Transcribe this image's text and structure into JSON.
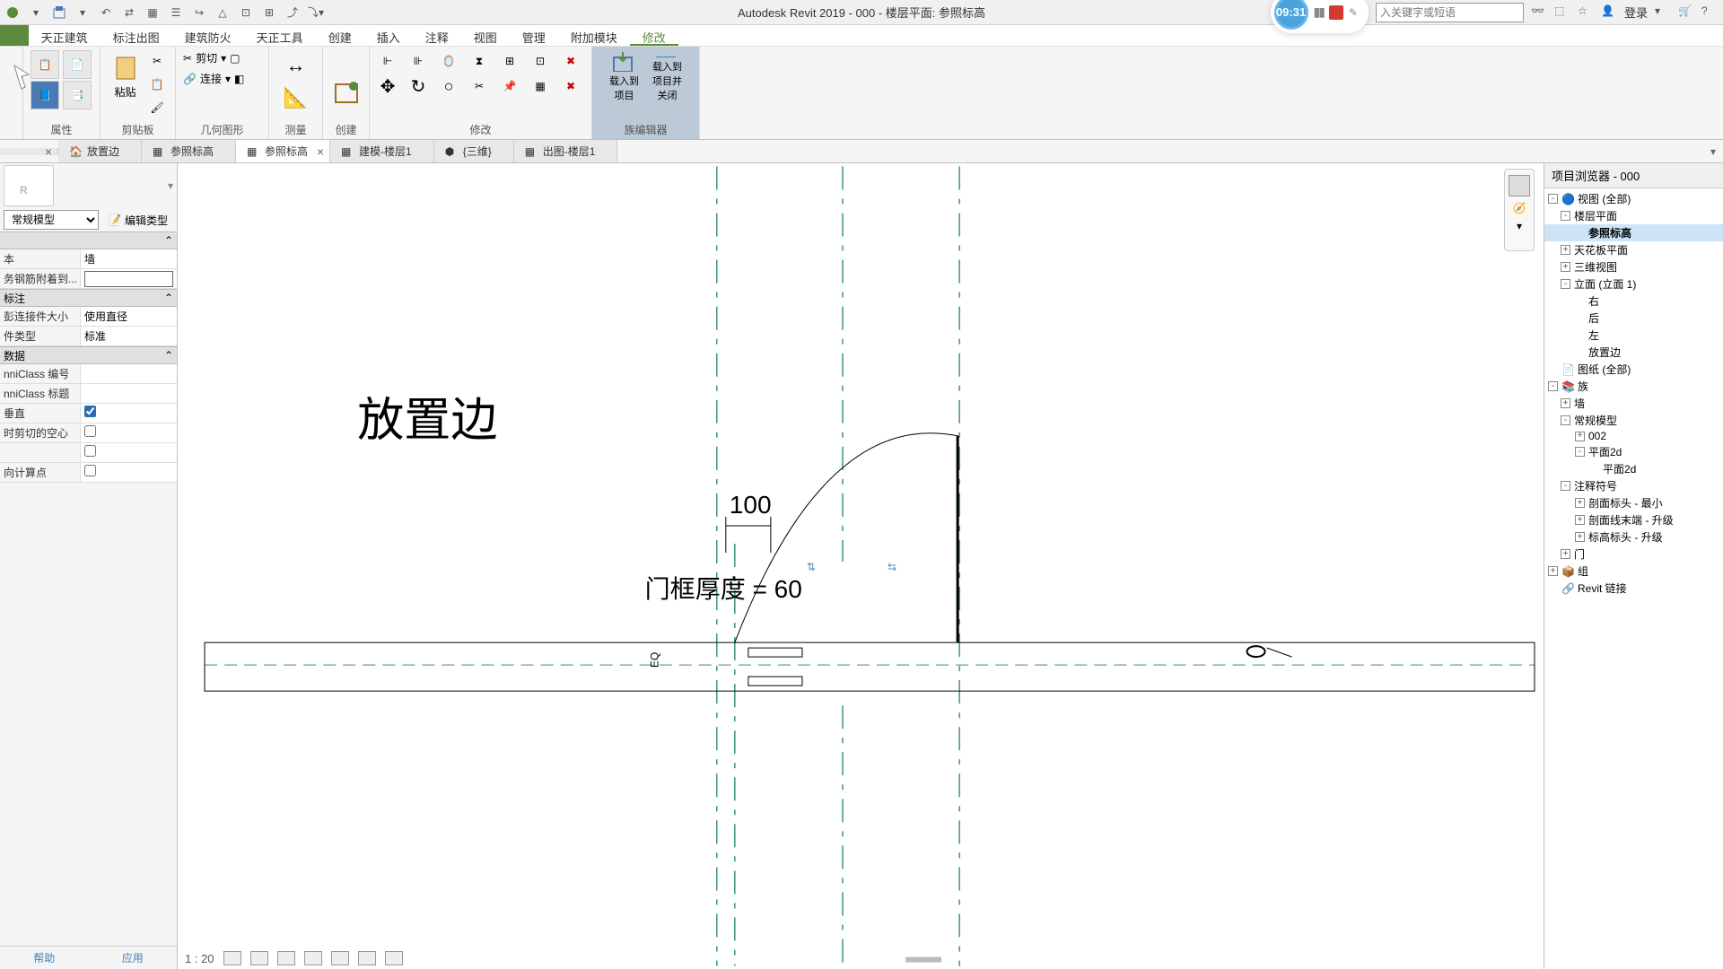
{
  "app_title": "Autodesk Revit 2019 - 000 - 楼层平面: 参照标高",
  "search_placeholder": "入关键字或短语",
  "login_label": "登录",
  "recorder_time": "09:31",
  "ribbon_tabs": [
    "天正建筑",
    "标注出图",
    "建筑防火",
    "天正工具",
    "创建",
    "插入",
    "注释",
    "视图",
    "管理",
    "附加模块",
    "修改"
  ],
  "ribbon_groups": {
    "properties": "属性",
    "clipboard": "剪贴板",
    "geometry": "几何图形",
    "measure": "测量",
    "create": "创建",
    "modify": "修改",
    "family_editor": "族编辑器"
  },
  "ribbon_labels": {
    "paste": "粘贴",
    "cut": "剪切",
    "connect": "连接",
    "load_project": "载入到\n项目",
    "load_close": "载入到\n项目并关闭"
  },
  "view_tabs": [
    {
      "label": "放置边",
      "close": true
    },
    {
      "label": "参照标高",
      "close": false
    },
    {
      "label": "参照标高",
      "close": true,
      "active": true
    },
    {
      "label": "建模-楼层1",
      "close": false
    },
    {
      "label": "{三维}",
      "close": false
    },
    {
      "label": "出图-楼层1",
      "close": false
    }
  ],
  "properties": {
    "type_selector": "常规模型",
    "edit_type": "编辑类型",
    "host_label": "本",
    "host_value": "墙",
    "rows": [
      {
        "l": "务钢筋附着到...",
        "type": "input",
        "v": ""
      },
      {
        "l": "标注",
        "type": "group"
      },
      {
        "l": "彭连接件大小",
        "type": "text",
        "v": "使用直径"
      },
      {
        "l": "件类型",
        "type": "text",
        "v": "标准"
      },
      {
        "l": "数据",
        "type": "group"
      },
      {
        "l": "nniClass 编号",
        "type": "text",
        "v": ""
      },
      {
        "l": "nniClass 标题",
        "type": "text",
        "v": ""
      },
      {
        "l": "垂直",
        "type": "check",
        "v": true
      },
      {
        "l": "时剪切的空心",
        "type": "check",
        "v": false
      },
      {
        "l": "",
        "type": "check",
        "v": false
      },
      {
        "l": "向计算点",
        "type": "check",
        "v": false
      }
    ],
    "help": "帮助",
    "apply": "应用"
  },
  "view_scale": "1 : 20",
  "canvas": {
    "label_place_side": "放置边",
    "dim_100": "100",
    "param_text": "门框厚度 = 60",
    "eq": "EQ"
  },
  "browser_title": "项目浏览器 - 000",
  "tree": [
    {
      "d": 0,
      "t": "-",
      "i": "view",
      "l": "视图 (全部)"
    },
    {
      "d": 1,
      "t": "-",
      "l": "楼层平面"
    },
    {
      "d": 2,
      "t": "",
      "l": "参照标高",
      "sel": true,
      "bold": true
    },
    {
      "d": 1,
      "t": "+",
      "l": "天花板平面"
    },
    {
      "d": 1,
      "t": "+",
      "l": "三维视图"
    },
    {
      "d": 1,
      "t": "-",
      "l": "立面 (立面 1)"
    },
    {
      "d": 2,
      "t": "",
      "l": "右"
    },
    {
      "d": 2,
      "t": "",
      "l": "后"
    },
    {
      "d": 2,
      "t": "",
      "l": "左"
    },
    {
      "d": 2,
      "t": "",
      "l": "放置边"
    },
    {
      "d": 0,
      "t": "",
      "i": "sheet",
      "l": "图纸 (全部)"
    },
    {
      "d": 0,
      "t": "-",
      "i": "family",
      "l": "族"
    },
    {
      "d": 1,
      "t": "+",
      "l": "墙"
    },
    {
      "d": 1,
      "t": "-",
      "l": "常规模型"
    },
    {
      "d": 2,
      "t": "+",
      "l": "002"
    },
    {
      "d": 2,
      "t": "-",
      "l": "平面2d"
    },
    {
      "d": 3,
      "t": "",
      "l": "平面2d"
    },
    {
      "d": 1,
      "t": "-",
      "l": "注释符号"
    },
    {
      "d": 2,
      "t": "+",
      "l": "剖面标头 - 最小"
    },
    {
      "d": 2,
      "t": "+",
      "l": "剖面线末端 - 升级"
    },
    {
      "d": 2,
      "t": "+",
      "l": "标高标头 - 升级"
    },
    {
      "d": 1,
      "t": "+",
      "l": "门"
    },
    {
      "d": 0,
      "t": "+",
      "i": "group",
      "l": "组"
    },
    {
      "d": 0,
      "t": "",
      "i": "link",
      "l": "Revit 链接"
    }
  ]
}
